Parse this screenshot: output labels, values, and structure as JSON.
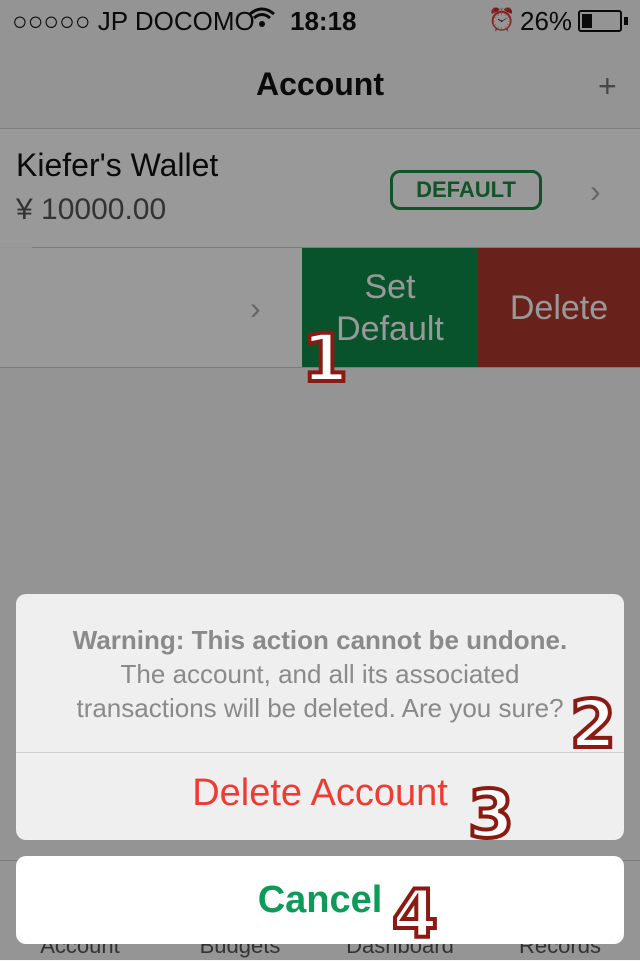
{
  "status_bar": {
    "carrier": "○○○○○ JP DOCOMO",
    "time": "18:18",
    "battery": "26%"
  },
  "nav": {
    "title": "Account",
    "add_label": "+"
  },
  "accounts": [
    {
      "name": "Kiefer's Wallet",
      "balance": "¥ 10000.00",
      "badge": "DEFAULT"
    }
  ],
  "swipe_actions": {
    "set_default": "Set Default",
    "delete": "Delete"
  },
  "tabs": [
    "Account",
    "Budgets",
    "Dashboard",
    "Records"
  ],
  "action_sheet": {
    "warning": "Warning: This action cannot be undone.",
    "line2": "The account, and all its associated",
    "line3": "transactions will be deleted. Are you sure?",
    "destructive": "Delete Account",
    "cancel": "Cancel"
  },
  "annotations": [
    "1",
    "2",
    "3",
    "4"
  ],
  "colors": {
    "accent_green": "#0e8a4a",
    "destructive_red": "#ee3b33",
    "delete_red": "#b03a2e"
  }
}
